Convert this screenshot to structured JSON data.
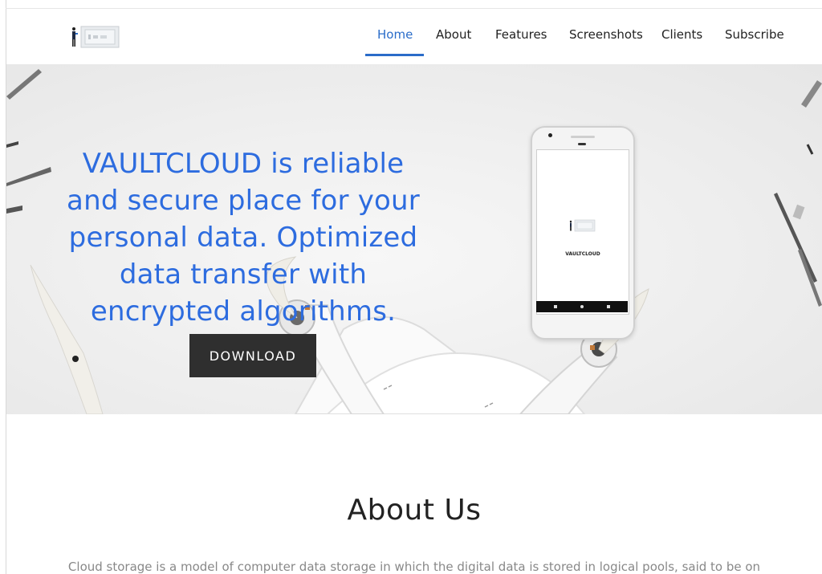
{
  "nav": {
    "items": [
      {
        "label": "Home",
        "active": true
      },
      {
        "label": "About",
        "active": false
      },
      {
        "label": "Features",
        "active": false
      },
      {
        "label": "Screenshots",
        "active": false
      },
      {
        "label": "Clients",
        "active": false
      },
      {
        "label": "Subscribe",
        "active": false
      }
    ],
    "accent": "#2a6cc9"
  },
  "hero": {
    "headline": "VAULTCLOUD is reliable and secure place for your personal data. Optimized data transfer with encrypted algorithms.",
    "cta_label": "DOWNLOAD",
    "phone_brand": "VAULTCLOUD",
    "headline_color": "#2d6cdf"
  },
  "about": {
    "title": "About Us",
    "text": "Cloud storage is a model of computer data storage in which the digital data is stored in logical pools, said to be on"
  }
}
